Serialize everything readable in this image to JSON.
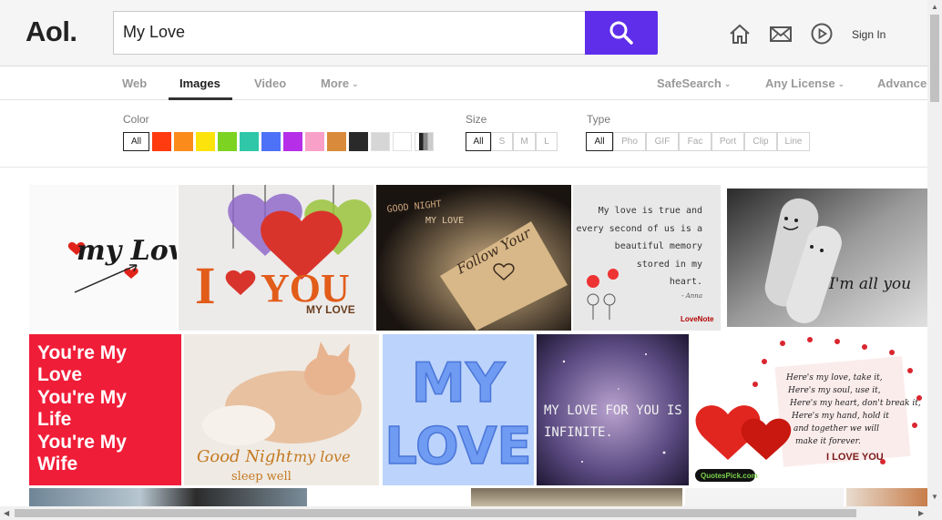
{
  "header": {
    "logo": "Aol.",
    "search_value": "My Love",
    "search_icon": "magnifier-icon",
    "icons": [
      "home-icon",
      "mail-icon",
      "video-play-icon"
    ],
    "signin": "Sign In",
    "accent": "#5f2eea"
  },
  "tabs": {
    "items": [
      {
        "label": "Web"
      },
      {
        "label": "Images"
      },
      {
        "label": "Video"
      },
      {
        "label": "More"
      }
    ],
    "active": "Images",
    "right": [
      {
        "label": "SafeSearch"
      },
      {
        "label": "Any License"
      },
      {
        "label": "Advanced"
      }
    ]
  },
  "filters": {
    "color_label": "Color",
    "color_all": "All",
    "colors": [
      "#ff3b0f",
      "#fb8c1c",
      "#fde30c",
      "#7dd321",
      "#2fc7a8",
      "#4e72f7",
      "#b62ee8",
      "#f9a0c8",
      "#d98b3b",
      "#2a2a2a",
      "#d6d6d6",
      "#ffffff"
    ],
    "size_label": "Size",
    "size_options": [
      "All",
      "S",
      "M",
      "L"
    ],
    "type_label": "Type",
    "type_options": [
      "All",
      "Pho",
      "GIF",
      "Fac",
      "Port",
      "Clip",
      "Line"
    ]
  },
  "images": {
    "row1": [
      {
        "text": "my Love"
      },
      {
        "text_a": "I",
        "text_b": "YOU",
        "caption": "MY LOVE"
      },
      {
        "text_a": "GOOD NIGHT",
        "text_b": "MY LOVE",
        "note": "Follow Your"
      },
      {
        "lines": [
          "My love is true and",
          "every second of us is a",
          "beautiful memory",
          "stored in my",
          "heart."
        ],
        "sign": "- Anna",
        "brand": "LoveNote"
      },
      {
        "text": "I'm all you"
      }
    ],
    "row2": [
      {
        "lines": [
          "You're My",
          "Love",
          "You're My",
          "Life",
          "You're My",
          "Wife"
        ]
      },
      {
        "line1": "Good Night",
        "line2": "my love",
        "line3": "sleep well"
      },
      {
        "line1": "MY",
        "line2": "LOVE"
      },
      {
        "line1": "MY LOVE FOR YOU IS",
        "line2": "INFINITE."
      },
      {
        "lines": [
          "Here's my love, take it,",
          "Here's my soul, use it,",
          "Here's my heart, don't break it,",
          "Here's my hand, hold it",
          "and together we will",
          "make it forever."
        ],
        "footer": "I LOVE YOU",
        "brand": "QuotesPick.com"
      }
    ]
  }
}
